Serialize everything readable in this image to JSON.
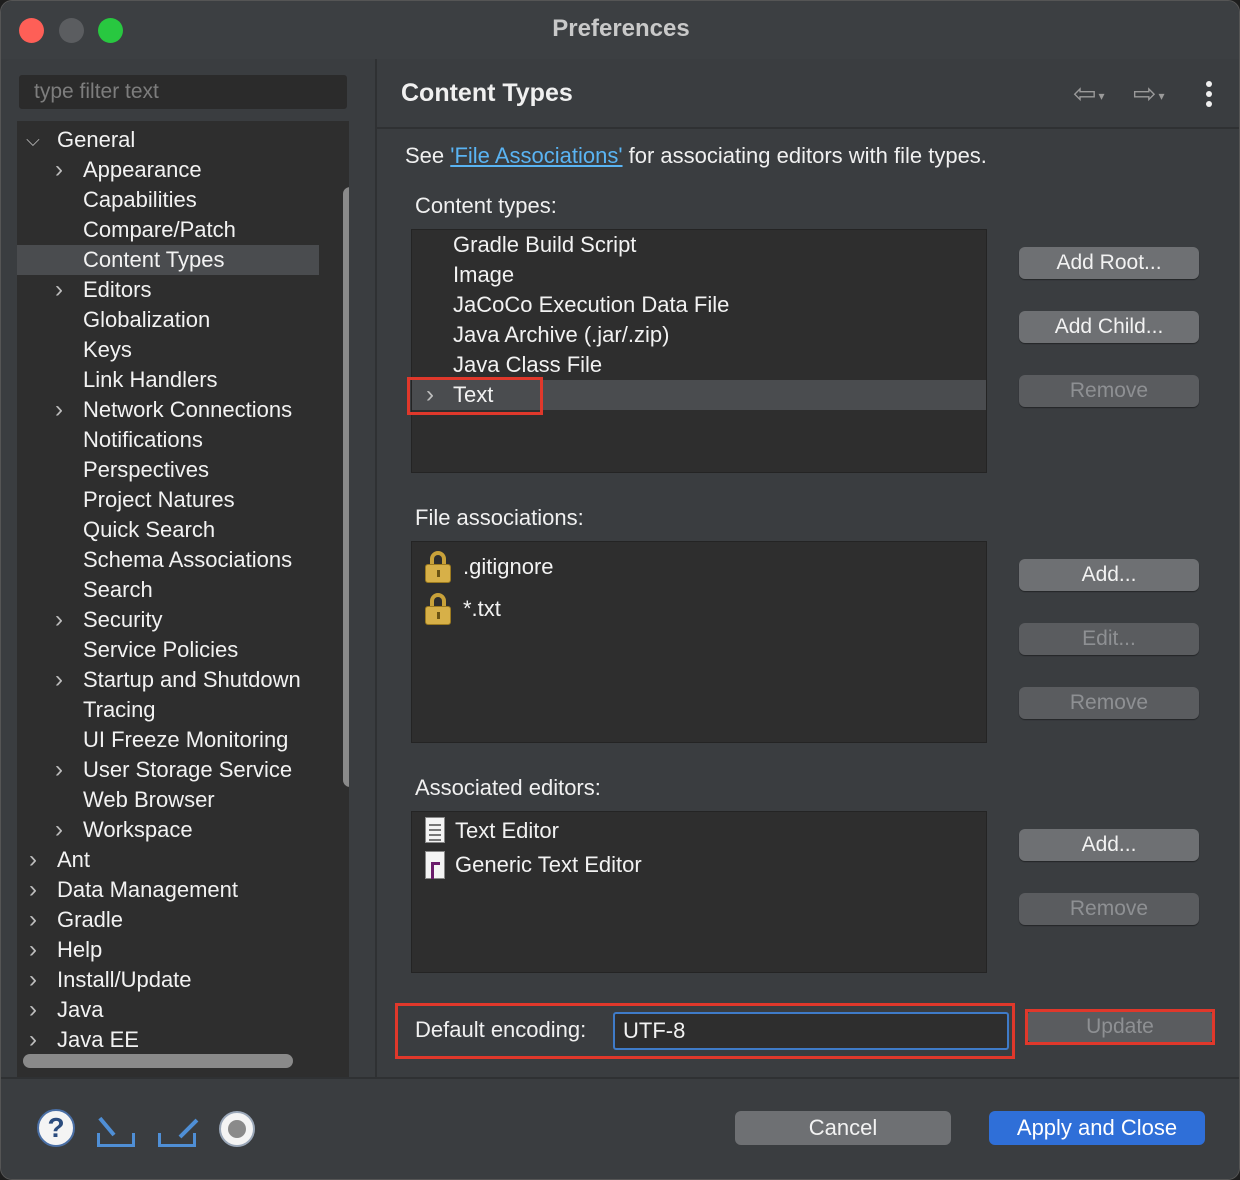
{
  "window": {
    "title": "Preferences"
  },
  "sidebar": {
    "filter_placeholder": "type filter text",
    "items": [
      {
        "label": "General",
        "level": 0,
        "twisty": "expanded",
        "selected": false
      },
      {
        "label": "Appearance",
        "level": 1,
        "twisty": "collapsed",
        "selected": false
      },
      {
        "label": "Capabilities",
        "level": 1,
        "twisty": "none",
        "selected": false
      },
      {
        "label": "Compare/Patch",
        "level": 1,
        "twisty": "none",
        "selected": false
      },
      {
        "label": "Content Types",
        "level": 1,
        "twisty": "none",
        "selected": true
      },
      {
        "label": "Editors",
        "level": 1,
        "twisty": "collapsed",
        "selected": false
      },
      {
        "label": "Globalization",
        "level": 1,
        "twisty": "none",
        "selected": false
      },
      {
        "label": "Keys",
        "level": 1,
        "twisty": "none",
        "selected": false
      },
      {
        "label": "Link Handlers",
        "level": 1,
        "twisty": "none",
        "selected": false
      },
      {
        "label": "Network Connections",
        "level": 1,
        "twisty": "collapsed",
        "selected": false
      },
      {
        "label": "Notifications",
        "level": 1,
        "twisty": "none",
        "selected": false
      },
      {
        "label": "Perspectives",
        "level": 1,
        "twisty": "none",
        "selected": false
      },
      {
        "label": "Project Natures",
        "level": 1,
        "twisty": "none",
        "selected": false
      },
      {
        "label": "Quick Search",
        "level": 1,
        "twisty": "none",
        "selected": false
      },
      {
        "label": "Schema Associations",
        "level": 1,
        "twisty": "none",
        "selected": false
      },
      {
        "label": "Search",
        "level": 1,
        "twisty": "none",
        "selected": false
      },
      {
        "label": "Security",
        "level": 1,
        "twisty": "collapsed",
        "selected": false
      },
      {
        "label": "Service Policies",
        "level": 1,
        "twisty": "none",
        "selected": false
      },
      {
        "label": "Startup and Shutdown",
        "level": 1,
        "twisty": "collapsed",
        "selected": false
      },
      {
        "label": "Tracing",
        "level": 1,
        "twisty": "none",
        "selected": false
      },
      {
        "label": "UI Freeze Monitoring",
        "level": 1,
        "twisty": "none",
        "selected": false
      },
      {
        "label": "User Storage Service",
        "level": 1,
        "twisty": "collapsed",
        "selected": false
      },
      {
        "label": "Web Browser",
        "level": 1,
        "twisty": "none",
        "selected": false
      },
      {
        "label": "Workspace",
        "level": 1,
        "twisty": "collapsed",
        "selected": false
      },
      {
        "label": "Ant",
        "level": 0,
        "twisty": "collapsed",
        "selected": false
      },
      {
        "label": "Data Management",
        "level": 0,
        "twisty": "collapsed",
        "selected": false
      },
      {
        "label": "Gradle",
        "level": 0,
        "twisty": "collapsed",
        "selected": false
      },
      {
        "label": "Help",
        "level": 0,
        "twisty": "collapsed",
        "selected": false
      },
      {
        "label": "Install/Update",
        "level": 0,
        "twisty": "collapsed",
        "selected": false
      },
      {
        "label": "Java",
        "level": 0,
        "twisty": "collapsed",
        "selected": false
      },
      {
        "label": "Java EE",
        "level": 0,
        "twisty": "collapsed",
        "selected": false
      }
    ]
  },
  "page": {
    "title": "Content Types",
    "see_prefix": "See ",
    "see_link": "'File Associations'",
    "see_suffix": " for associating editors with file types.",
    "content_types_label": "Content types:",
    "content_types": [
      {
        "label": "Gradle Build Script",
        "twisty": "none",
        "selected": false
      },
      {
        "label": "Image",
        "twisty": "none",
        "selected": false
      },
      {
        "label": "JaCoCo Execution Data File",
        "twisty": "none",
        "selected": false
      },
      {
        "label": "Java Archive (.jar/.zip)",
        "twisty": "none",
        "selected": false
      },
      {
        "label": "Java Class File",
        "twisty": "none",
        "selected": false
      },
      {
        "label": "Text",
        "twisty": "collapsed",
        "selected": true
      }
    ],
    "content_type_buttons": {
      "add_root": "Add Root...",
      "add_child": "Add Child...",
      "remove": "Remove"
    },
    "file_associations_label": "File associations:",
    "file_associations": [
      {
        "label": ".gitignore",
        "icon": "lock-icon"
      },
      {
        "label": "*.txt",
        "icon": "lock-icon"
      }
    ],
    "file_assoc_buttons": {
      "add": "Add...",
      "edit": "Edit...",
      "remove": "Remove"
    },
    "associated_editors_label": "Associated editors:",
    "associated_editors": [
      {
        "label": "Text Editor",
        "icon": "text-editor-icon"
      },
      {
        "label": "Generic Text Editor",
        "icon": "generic-editor-icon"
      }
    ],
    "editor_buttons": {
      "add": "Add...",
      "remove": "Remove"
    },
    "default_encoding_label": "Default encoding:",
    "default_encoding_value": "UTF-8",
    "update_button": "Update"
  },
  "footer": {
    "cancel": "Cancel",
    "apply_close": "Apply and Close"
  },
  "colors": {
    "accent": "#2f6fd8",
    "link": "#5ab4f3",
    "highlight_box": "#e0382b",
    "selection": "#4a4c4f"
  }
}
